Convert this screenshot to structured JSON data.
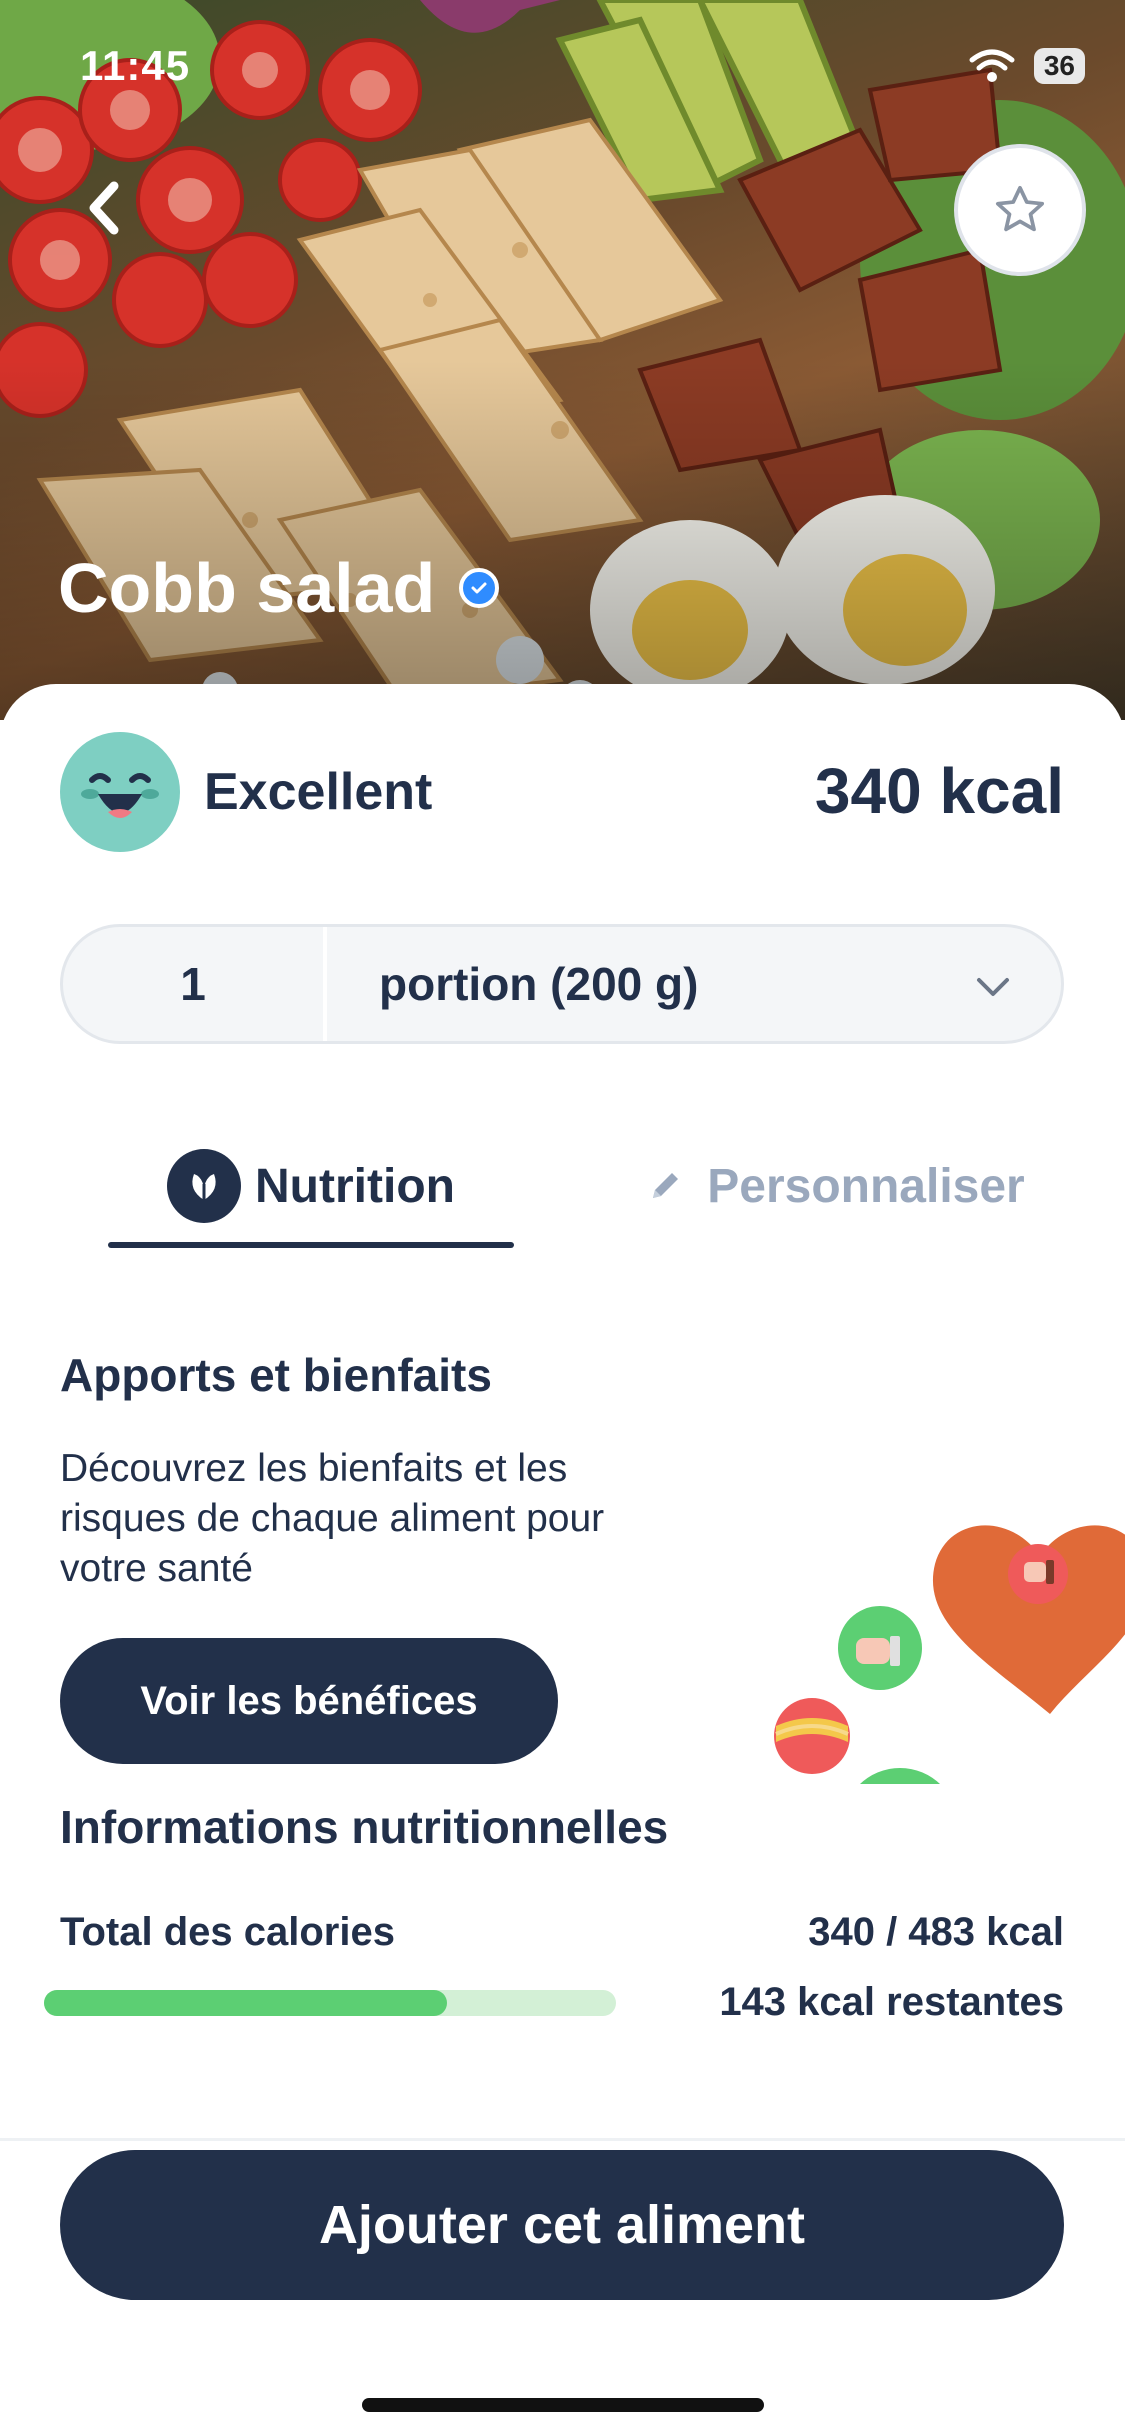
{
  "status": {
    "time": "11:45",
    "battery": "36"
  },
  "header": {
    "title": "Cobb salad"
  },
  "score": {
    "label": "Excellent",
    "kcal": "340 kcal"
  },
  "portion": {
    "quantity": "1",
    "unit": "portion (200 g)"
  },
  "tabs": [
    {
      "label": "Nutrition",
      "active": true
    },
    {
      "label": "Personnaliser",
      "active": false
    }
  ],
  "benefits": {
    "title": "Apports et bienfaits",
    "description": "Découvrez les bienfaits et les risques de chaque aliment pour votre santé",
    "button_label": "Voir les bénéfices"
  },
  "nutrition": {
    "title": "Informations nutritionnelles",
    "calories_label": "Total des calories",
    "calories_value": "340 / 483 kcal",
    "remaining": "143 kcal restantes",
    "progress_fraction": 0.704
  },
  "footer": {
    "add_button_label": "Ajouter cet aliment"
  },
  "icons": {
    "back": "chevron-left-icon",
    "favorite": "star-icon",
    "verified": "verified-check-icon",
    "leaf": "leaf-icon",
    "pencil": "pencil-icon",
    "chevron": "chevron-down-icon"
  },
  "colors": {
    "primary": "#22304a",
    "accent_green": "#5ccf73",
    "muted": "#9aa8bd",
    "verified_blue": "#2f8cff",
    "score_face": "#7ecfc2"
  }
}
